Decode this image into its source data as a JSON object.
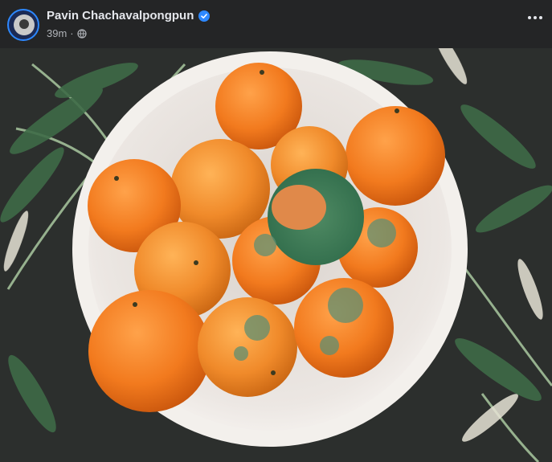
{
  "post": {
    "author_name": "Pavin Chachavalpongpun",
    "verified": true,
    "timestamp": "39m",
    "separator": "·",
    "audience_icon": "globe-icon",
    "more_icon": "more-horizontal-icon"
  },
  "photo": {
    "subject": "bowl of moldy mandarin oranges"
  },
  "colors": {
    "header_bg": "#242526",
    "text_primary": "#e4e6eb",
    "text_secondary": "#b0b3b8",
    "verified_badge": "#2d88ff"
  }
}
